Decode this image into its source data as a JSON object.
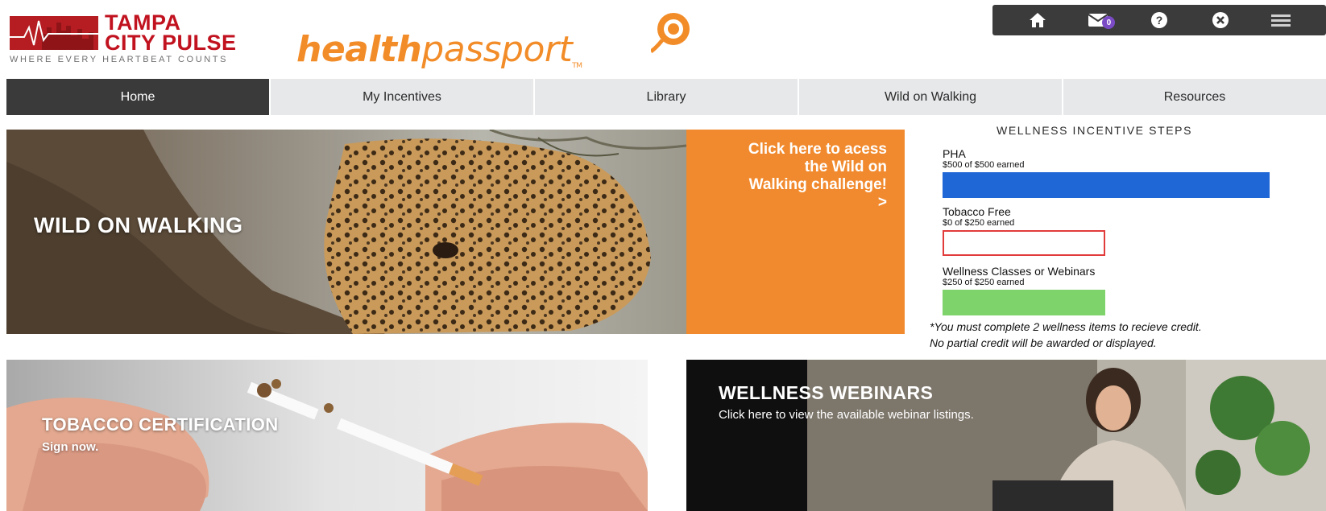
{
  "brand": {
    "tcp_name_line1": "TAMPA",
    "tcp_name_line2": "CITY PULSE",
    "tcp_tagline": "WHERE EVERY HEARTBEAT COUNTS",
    "hp_bold": "health",
    "hp_light": "passport",
    "hp_tm": "TM",
    "orange": "#f28c28",
    "red": "#c1121f"
  },
  "utility_bar": {
    "icons": [
      "home-icon",
      "mail-icon",
      "help-icon",
      "close-icon",
      "menu-icon"
    ],
    "mail_count": "0"
  },
  "nav": {
    "tabs": [
      {
        "label": "Home",
        "active": true
      },
      {
        "label": "My Incentives",
        "active": false
      },
      {
        "label": "Library",
        "active": false
      },
      {
        "label": "Wild on Walking",
        "active": false
      },
      {
        "label": "Resources",
        "active": false
      }
    ]
  },
  "hero": {
    "title": "WILD ON WALKING",
    "cta_line1": "Click here to acess",
    "cta_line2": "the Wild on",
    "cta_line3": "Walking challenge!",
    "cta_arrow": ">"
  },
  "incentives": {
    "heading": "WELLNESS INCENTIVE STEPS",
    "steps": [
      {
        "label": "PHA",
        "earned": "$500 of $500 earned",
        "progress": 1.0,
        "color": "#1f66d6"
      },
      {
        "label": "Tobacco Free",
        "earned": "$0 of $250 earned",
        "progress": 0.0,
        "color": "#e23b3b"
      },
      {
        "label": "Wellness Classes or Webinars",
        "earned": "$250 of $250 earned",
        "progress": 1.0,
        "color": "#7ed36b"
      }
    ],
    "note_line1": "*You must complete 2 wellness items to recieve credit.",
    "note_line2": "No partial credit will be awarded or displayed."
  },
  "cards": {
    "tobacco_title": "TOBACCO CERTIFICATION",
    "tobacco_sub": "Sign now.",
    "webinar_title": "WELLNESS WEBINARS",
    "webinar_sub": "Click here to view the available webinar listings."
  }
}
